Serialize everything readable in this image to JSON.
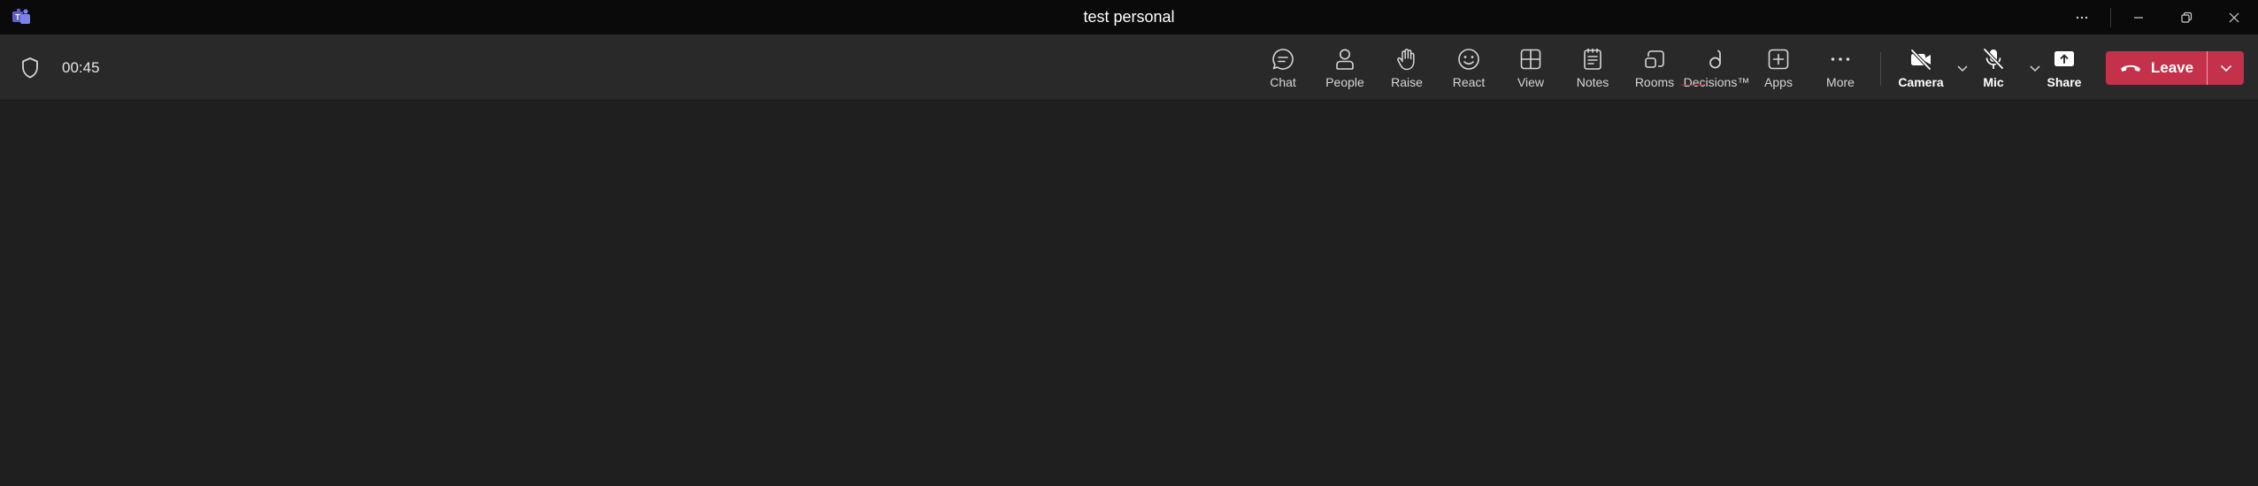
{
  "window": {
    "title": "test personal"
  },
  "meeting": {
    "timer": "00:45"
  },
  "toolbar": {
    "items": [
      {
        "label": "Chat",
        "icon": "chat-icon"
      },
      {
        "label": "People",
        "icon": "people-icon"
      },
      {
        "label": "Raise",
        "icon": "raise-hand-icon"
      },
      {
        "label": "React",
        "icon": "smiley-icon"
      },
      {
        "label": "View",
        "icon": "grid-icon"
      },
      {
        "label": "Notes",
        "icon": "notes-icon"
      },
      {
        "label": "Rooms",
        "icon": "rooms-icon"
      },
      {
        "label": "Decisions™",
        "icon": "decisions-icon"
      },
      {
        "label": "Apps",
        "icon": "apps-plus-icon"
      },
      {
        "label": "More",
        "icon": "more-dots-icon"
      }
    ],
    "camera_label": "Camera",
    "mic_label": "Mic",
    "share_label": "Share",
    "leave_label": "Leave"
  },
  "colors": {
    "titlebar": "#0a0a0a",
    "toolbar": "#292929",
    "stage": "#1f1f1f",
    "leave": "#c4314b",
    "annotation": "#e0202a"
  }
}
